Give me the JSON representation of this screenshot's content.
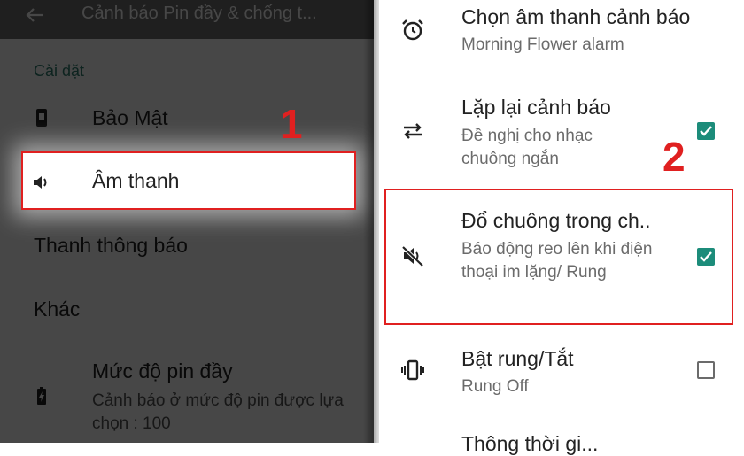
{
  "left": {
    "app_title": "Cảnh báo Pin đầy & chống t...",
    "section_header": "Cài đặt",
    "items": [
      {
        "label": "Bảo Mật",
        "icon": "phone-lock-icon"
      },
      {
        "label": "Âm thanh",
        "icon": "speaker-icon"
      },
      {
        "label": "Thanh thông báo"
      },
      {
        "label": "Khác"
      },
      {
        "label": "Mức độ pin đầy",
        "subtitle": "Cảnh báo ở mức độ pin được lựa chọn : 100",
        "icon": "battery-charging-icon"
      }
    ]
  },
  "annotations": {
    "step1": "1",
    "step2": "2",
    "color": "#e02020"
  },
  "right": {
    "items": [
      {
        "title": "Chọn âm thanh cảnh báo",
        "subtitle": "Morning Flower alarm",
        "icon": "alarm-clock-icon"
      },
      {
        "title": "Lặp lại cảnh báo",
        "subtitle": "Đề nghị cho nhạc chuông ngắn",
        "icon": "repeat-icon",
        "checked": true
      },
      {
        "title": "Đổ chuông trong ch..",
        "subtitle": "Báo động reo lên khi điện thoại im lặng/ Rung",
        "icon": "volume-off-icon",
        "checked": true
      },
      {
        "title": "Bật rung/Tắt",
        "subtitle": "Rung Off",
        "icon": "vibrate-icon",
        "checked": false
      },
      {
        "title": "Thông thời gi...",
        "icon": "clock-icon"
      }
    ]
  },
  "colors": {
    "accent": "#1c8c7a",
    "section_header": "#2f7f6f"
  }
}
